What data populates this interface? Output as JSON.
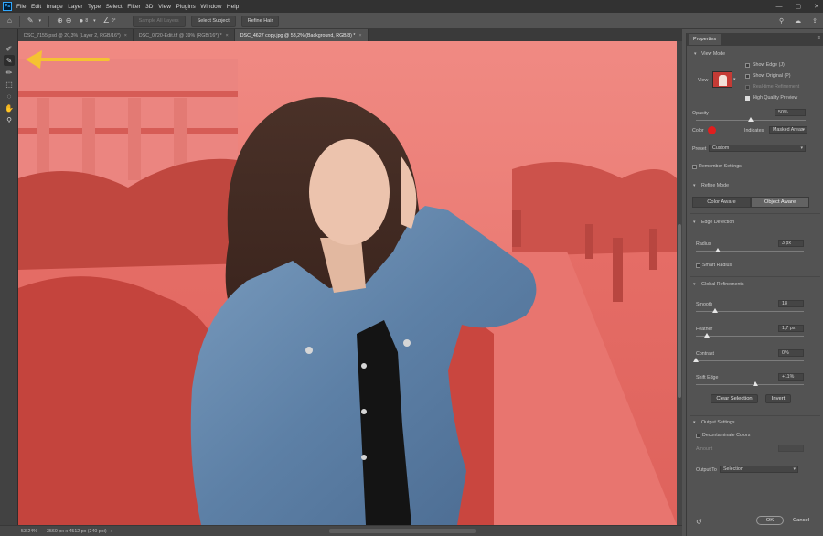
{
  "app": {
    "logo": "Ps"
  },
  "menu": [
    "File",
    "Edit",
    "Image",
    "Layer",
    "Type",
    "Select",
    "Filter",
    "3D",
    "View",
    "Plugins",
    "Window",
    "Help"
  ],
  "window_controls": [
    "—",
    "▢",
    "✕"
  ],
  "options_bar": {
    "brush_size": "8",
    "angle": "0°",
    "sample_all_layers": "Sample All Layers",
    "select_subject": "Select Subject",
    "refine_hair": "Refine Hair",
    "icons": [
      "home-icon",
      "brush-icon",
      "add-icon",
      "subtract-icon",
      "brush-preset-icon",
      "angle-icon",
      "search-icon",
      "cloud-icon",
      "share-icon"
    ]
  },
  "tabs": [
    {
      "label": "DSC_7155.psd @ 20,3% (Layer 2, RGB/16*)",
      "close": "×"
    },
    {
      "label": "DSC_0720-Edit.tif @ 39% (RGB/16*) *",
      "close": "×"
    },
    {
      "label": "DSC_4627 copy.jpg @ 53,2% (Background, RGB/8) *",
      "close": "×"
    }
  ],
  "tools": [
    "quick-selection-icon",
    "refine-edge-brush-icon",
    "brush-icon",
    "object-selection-icon",
    "lasso-icon",
    "hand-icon",
    "zoom-icon"
  ],
  "canvas": {
    "overlay_color": "#ef4c46",
    "arrow_color": "#f5c232"
  },
  "status": {
    "zoom": "53,24%",
    "doc_size": "3560 px x 4512 px (240 ppi)",
    "arrow": "›"
  },
  "properties": {
    "title": "Properties",
    "menu": "≡",
    "view_mode": {
      "heading": "View Mode",
      "view_label": "View",
      "show_edge": "Show Edge (J)",
      "show_original": "Show Original (P)",
      "realtime_refinement": "Real-time Refinement",
      "high_quality_preview": "High Quality Preview",
      "high_quality_checked": true
    },
    "opacity": {
      "label": "Opacity",
      "value": "50%",
      "level": 0.5
    },
    "color": {
      "label": "Color",
      "swatch": "#e01e1e",
      "indicates_label": "Indicates",
      "indicates_value": "Masked Areas"
    },
    "preset": {
      "label": "Preset",
      "value": "Custom"
    },
    "remember_settings": "Remember Settings",
    "refine_mode": {
      "heading": "Refine Mode",
      "color_aware": "Color Aware",
      "object_aware": "Object Aware"
    },
    "edge_detection": {
      "heading": "Edge Detection",
      "radius_label": "Radius",
      "radius_value": "3 px",
      "radius_level": 0.2,
      "smart_radius": "Smart Radius"
    },
    "global_refinements": {
      "heading": "Global Refinements",
      "smooth_label": "Smooth",
      "smooth_value": "18",
      "smooth_level": 0.18,
      "feather_label": "Feather",
      "feather_value": "1,7 px",
      "feather_level": 0.1,
      "contrast_label": "Contrast",
      "contrast_value": "0%",
      "contrast_level": 0.0,
      "shift_edge_label": "Shift Edge",
      "shift_edge_value": "+11%",
      "shift_edge_level": 0.555,
      "clear_selection": "Clear Selection",
      "invert": "Invert"
    },
    "output": {
      "heading": "Output Settings",
      "decontaminate": "Decontaminate Colors",
      "amount_label": "Amount",
      "output_to_label": "Output To",
      "output_to_value": "Selection"
    },
    "ok": "OK",
    "cancel": "Cancel",
    "reset_icon": "reset-icon"
  }
}
